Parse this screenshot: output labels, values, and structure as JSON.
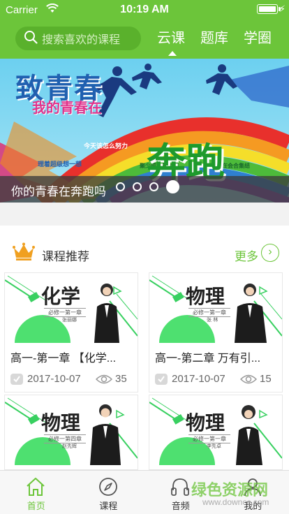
{
  "status_bar": {
    "carrier": "Carrier",
    "time": "10:19 AM"
  },
  "header": {
    "search_placeholder": "搜索喜欢的课程",
    "tabs": [
      {
        "label": "云课",
        "active": true
      },
      {
        "label": "题库",
        "active": false
      },
      {
        "label": "学圈",
        "active": false
      }
    ]
  },
  "banner": {
    "headline": "致青春",
    "subline": "我的青春在",
    "big_word": "奔跑",
    "caption": "你的青春在奔跑吗",
    "slide_count": 4,
    "active_slide": 4
  },
  "recommend": {
    "title": "课程推荐",
    "more_label": "更多",
    "courses": [
      {
        "subject": "化学",
        "chapter": "必修一第一章",
        "teacher": "张丽娜",
        "title": "高一-第一章 【化学...",
        "date": "2017-10-07",
        "views": "35"
      },
      {
        "subject": "物理",
        "chapter": "必修一第一章",
        "teacher": "张 林",
        "title": "高一-第二章 万有引...",
        "date": "2017-10-07",
        "views": "15"
      },
      {
        "subject": "物理",
        "chapter": "必修一第四章",
        "teacher": "赵先辉",
        "title": "",
        "date": "",
        "views": ""
      },
      {
        "subject": "物理",
        "chapter": "必修一第一章",
        "teacher": "李先卓",
        "title": "",
        "date": "",
        "views": ""
      }
    ]
  },
  "tabbar": {
    "items": [
      {
        "label": "首页",
        "icon": "home-icon",
        "active": true
      },
      {
        "label": "课程",
        "icon": "compass-icon",
        "active": false
      },
      {
        "label": "音频",
        "icon": "headphones-icon",
        "active": false
      },
      {
        "label": "我的",
        "icon": "user-icon",
        "active": false
      }
    ]
  },
  "watermark": {
    "text": "绿色资源网",
    "url_text": "www.downcc.com"
  },
  "colors": {
    "brand_green": "#6cc53a",
    "search_bg": "#5ab12c",
    "crown": "#f0a020"
  }
}
